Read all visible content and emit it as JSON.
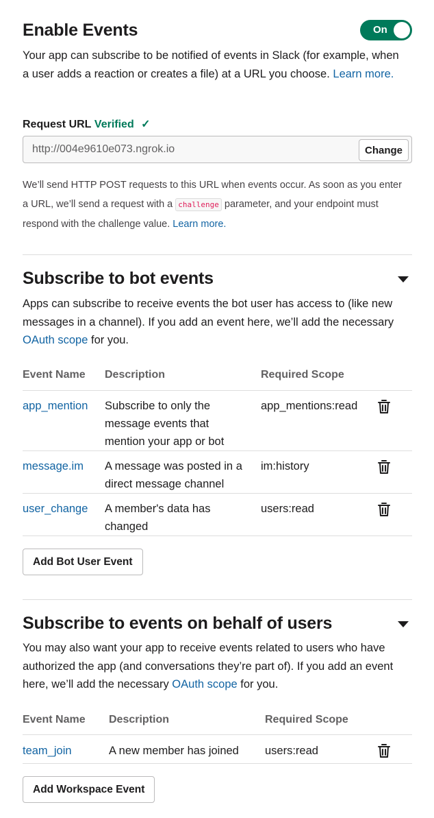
{
  "enable_events": {
    "title": "Enable Events",
    "toggle_label": "On",
    "description": "Your app can subscribe to be notified of events in Slack (for example, when a user adds a reaction or creates a file) at a URL you choose.",
    "learn_more": "Learn more."
  },
  "request_url": {
    "label": "Request URL",
    "status": "Verified",
    "check_icon": "checkmark-icon",
    "value": "http://004e9610e073.ngrok.io",
    "change_label": "Change",
    "help_before": "We’ll send HTTP POST requests to this URL when events occur. As soon as you enter a URL, we’ll send a request with a",
    "help_code": "challenge",
    "help_after": "parameter, and your endpoint must respond with the challenge value.",
    "learn_more": "Learn more."
  },
  "bot_events": {
    "title": "Subscribe to bot events",
    "description": "Apps can subscribe to receive events the bot user has access to (like new messages in a channel). If you add an event here, we’ll add the necessary",
    "oauth_link": "OAuth scope",
    "description_end": "for you.",
    "columns": [
      "Event Name",
      "Description",
      "Required Scope"
    ],
    "rows": [
      {
        "name": "app_mention",
        "description": "Subscribe to only the message events that mention your app or bot",
        "scope": "app_mentions:read"
      },
      {
        "name": "message.im",
        "description": "A message was posted in a direct message channel",
        "scope": "im:history"
      },
      {
        "name": "user_change",
        "description": "A member's data has changed",
        "scope": "users:read"
      }
    ],
    "add_button": "Add Bot User Event"
  },
  "user_events": {
    "title": "Subscribe to events on behalf of users",
    "description": "You may also want your app to receive events related to users who have authorized the app (and conversations they’re part of). If you add an event here, we’ll add the necessary",
    "oauth_link": "OAuth scope",
    "description_end": "for you.",
    "columns": [
      "Event Name",
      "Description",
      "Required Scope"
    ],
    "rows": [
      {
        "name": "team_join",
        "description": "A new member has joined",
        "scope": "users:read"
      }
    ],
    "add_button": "Add Workspace Event"
  },
  "icons": {
    "trash": "trash-icon",
    "caret": "caret-down-icon"
  },
  "colors": {
    "accent_green": "#007a5a",
    "link_blue": "#1264a3",
    "code_pink": "#e01e5a"
  }
}
